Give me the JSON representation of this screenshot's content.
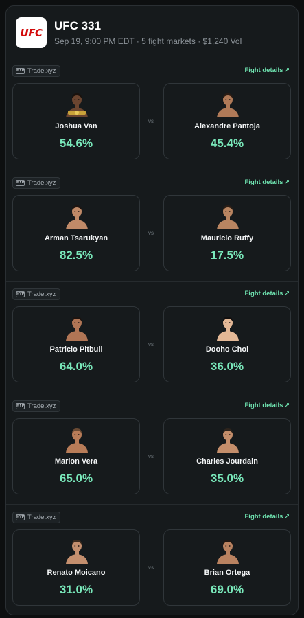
{
  "event": {
    "title": "UFC 331",
    "subtitle": "Sep 19, 9:00 PM EDT · 5 fight markets · $1,240 Vol",
    "logo_text": "UFC"
  },
  "labels": {
    "platform": "Trade.xyz",
    "platform_icon_text": "HYP",
    "fight_details": "Fight details",
    "vs": "vs"
  },
  "colors": {
    "accent": "#6fe3b0",
    "probability": "#79e8ba",
    "brand_red": "#d20a0a"
  },
  "fights": [
    {
      "fighter_a": {
        "name": "Joshua Van",
        "probability": "54.6%",
        "skin": "#6b4530",
        "hair": "#1a120d",
        "gold": true
      },
      "fighter_b": {
        "name": "Alexandre Pantoja",
        "probability": "45.4%",
        "skin": "#b07a58",
        "hair": "#2a1c14"
      }
    },
    {
      "fighter_a": {
        "name": "Arman Tsarukyan",
        "probability": "82.5%",
        "skin": "#c08a68",
        "hair": "#1e1511"
      },
      "fighter_b": {
        "name": "Mauricio Ruffy",
        "probability": "17.5%",
        "skin": "#b98561",
        "hair": "#2b1e16"
      }
    },
    {
      "fighter_a": {
        "name": "Patricio Pitbull",
        "probability": "64.0%",
        "skin": "#b07555",
        "hair": "#1d1410"
      },
      "fighter_b": {
        "name": "Dooho Choi",
        "probability": "36.0%",
        "skin": "#e3b896",
        "hair": "#121010"
      }
    },
    {
      "fighter_a": {
        "name": "Marlon Vera",
        "probability": "65.0%",
        "skin": "#b87c58",
        "hair": "#6a4a33"
      },
      "fighter_b": {
        "name": "Charles Jourdain",
        "probability": "35.0%",
        "skin": "#c48e6b",
        "hair": "#2e241c"
      }
    },
    {
      "fighter_a": {
        "name": "Renato Moicano",
        "probability": "31.0%",
        "skin": "#c48f6e",
        "hair": "#3b2a1e"
      },
      "fighter_b": {
        "name": "Brian Ortega",
        "probability": "69.0%",
        "skin": "#b98260",
        "hair": "#1f1713"
      }
    }
  ]
}
